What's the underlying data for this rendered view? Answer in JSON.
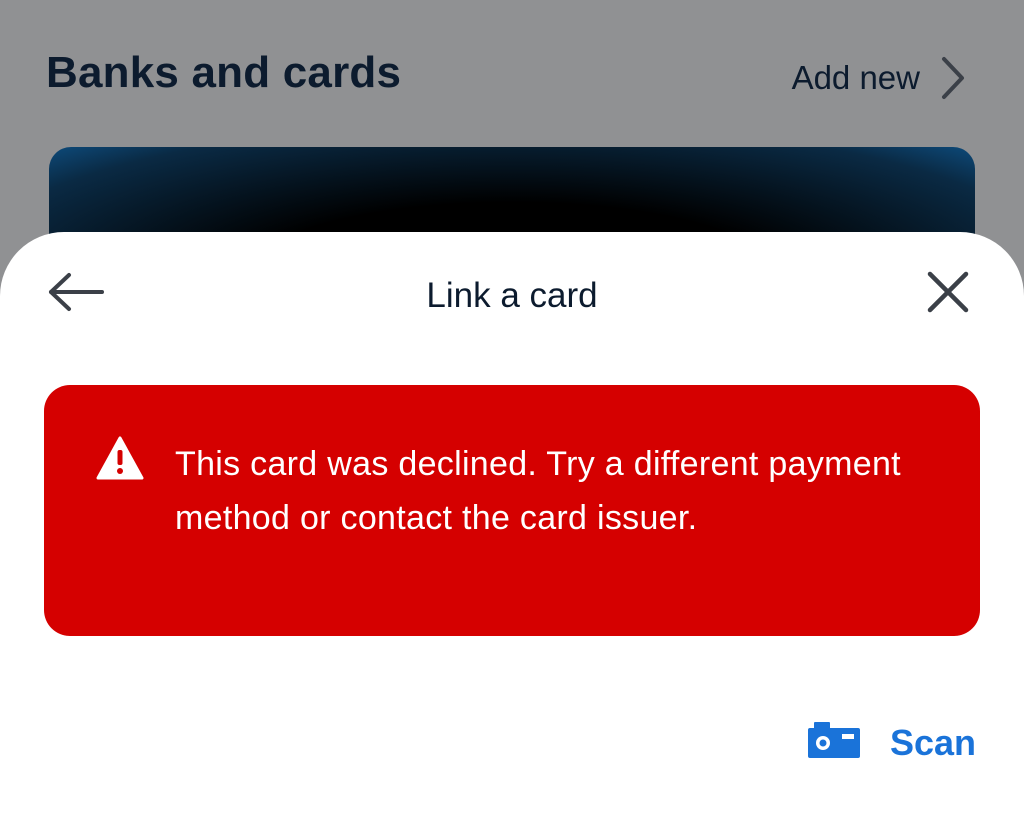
{
  "background": {
    "title": "Banks and cards",
    "add_new_label": "Add new"
  },
  "sheet": {
    "title": "Link a card",
    "alert_message": "This card was declined. Try a different payment method or contact the card issuer.",
    "scan_label": "Scan"
  },
  "icons": {
    "back": "arrow-left-icon",
    "close": "close-icon",
    "alert": "warning-triangle-icon",
    "scan": "camera-icon",
    "add_new": "chevron-right-icon"
  },
  "colors": {
    "alert_bg": "#d50000",
    "accent": "#1a73d9",
    "overlay": "#909193",
    "text_dark": "#0c1b2e"
  }
}
